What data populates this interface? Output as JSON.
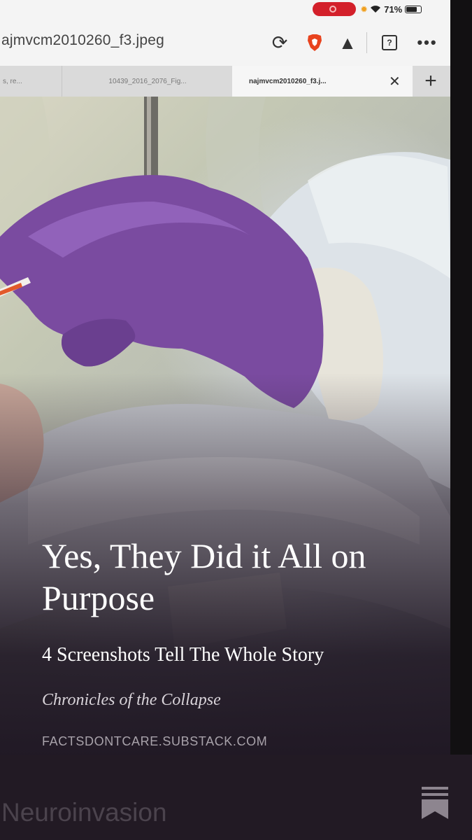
{
  "status_bar": {
    "battery_label": "71%",
    "battery_level": 0.71,
    "icons": [
      "recording-indicator",
      "sun-icon",
      "wifi-icon",
      "battery-icon"
    ]
  },
  "browser": {
    "url": "ajmvcm2010260_f3.jpeg",
    "tabs": [
      {
        "label": "s, re...",
        "active": false
      },
      {
        "label": "10439_2016_2076_Fig...",
        "active": false
      },
      {
        "label": "najmvcm2010260_f3.j...",
        "active": true
      }
    ],
    "toolbar_icons": [
      "reload-icon",
      "brave-shield-icon",
      "warning-icon",
      "tabs-icon",
      "more-menu-icon"
    ],
    "tab_count_label": "?",
    "menu_label": "•••",
    "close_label": "✕",
    "new_tab_label": "+"
  },
  "article": {
    "title": "Yes, They Did it All on Purpose",
    "subtitle": "4 Screenshots Tell The Whole Story",
    "publication": "Chronicles of the Collapse",
    "domain": "FACTSDONTCARE.SUBSTACK.COM"
  },
  "bottom": {
    "label": "Neuroinvasion"
  },
  "colors": {
    "glove_purple": "#7a4ba0",
    "overlay_dark": "#221a24",
    "record_red": "#d3202a",
    "brave_orange": "#e8431e"
  }
}
